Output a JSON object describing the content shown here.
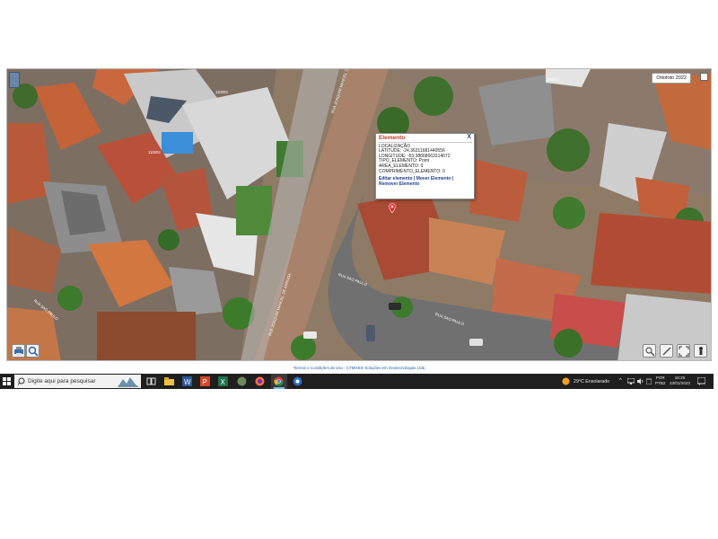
{
  "map": {
    "ortho_label": "Ortofoto 2022",
    "lot_labels": [
      "110003",
      "110003",
      "1/080.1"
    ],
    "street_labels": [
      "RUA JOAQUIM MANOEL DE ARRUDA",
      "RUA JOAQUIM MANOEL DE ARRUDA",
      "RUA SAO PAULO",
      "RUA SAO PAULO",
      "RUA SAO PAULO"
    ]
  },
  "popup": {
    "title": "Elemento",
    "close": "X",
    "rows": [
      "LOCALIZAÇÃO",
      "LATITUDE: -24.36311681440556",
      "LONGITUDE: -53.38668663314672",
      "TIPO_ELEMENTO: Point",
      "AREA_ELEMENTO: 0",
      "COMPRIMENTO_ELEMENTO: 0"
    ],
    "link_edit": "Editar elemento",
    "sep1": " | ",
    "link_move": "Mover Elemento",
    "sep2": " | ",
    "link_remove": "Remover Elemento"
  },
  "footer": {
    "terms": "Termos e Condições de Uso - CTMGEO Soluções em Geotecnologias Ltda"
  },
  "taskbar": {
    "search_placeholder": "Digite aqui para pesquisar",
    "weather": "29°C  Ensolarado",
    "lang_top": "POR",
    "lang_bottom": "PTB2",
    "time": "18:25",
    "date": "23/01/2023",
    "icons": [
      "task-view-icon",
      "file-explorer-icon",
      "word-icon",
      "powerpoint-icon",
      "excel-icon",
      "app-icon",
      "firefox-icon",
      "chrome-icon",
      "browser-icon"
    ]
  }
}
